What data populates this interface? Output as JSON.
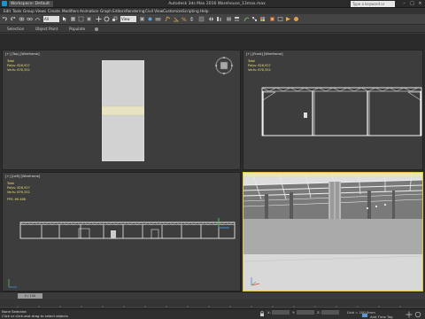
{
  "title_bar": {
    "workspace": "Workspace: Default",
    "title": "Autodesk 3ds Max 2016   Warehouse_13max.max",
    "search_placeholder": "Type a keyword or phrase"
  },
  "menu": [
    "Edit",
    "Tools",
    "Group",
    "Views",
    "Create",
    "Modifiers",
    "Animation",
    "Graph Editors",
    "Rendering",
    "Civil View",
    "Customize",
    "Scripting",
    "Help"
  ],
  "toolbar": {
    "filter_select": "All",
    "view_select": "View"
  },
  "ribbon": [
    "Selection",
    "Object Paint",
    "Populate"
  ],
  "viewports": {
    "top": {
      "label": "[+] [Top] [Wireframe]",
      "total_label": "Total",
      "polys_label": "Polys:",
      "polys": "826,927",
      "verts_label": "Verts:",
      "verts": "676,352"
    },
    "front": {
      "label": "[+] [Front] [Wireframe]",
      "total_label": "Total",
      "polys_label": "Polys:",
      "polys": "826,927",
      "verts_label": "Verts:",
      "verts": "676,352"
    },
    "left": {
      "label": "[+] [Left] [Wireframe]",
      "total_label": "Total",
      "polys_label": "Polys:",
      "polys": "826,927",
      "verts_label": "Verts:",
      "verts": "676,352",
      "fps_label": "FPS:",
      "fps": "69.466"
    },
    "perspective": {
      "label": "[+] [Perspective] [Realistic]"
    }
  },
  "timeline": {
    "slider_label": "0 / 100"
  },
  "status": {
    "selection": "None Selected",
    "prompt": "Click or click-and-drag to select objects",
    "x_label": "X:",
    "y_label": "Y:",
    "z_label": "Z:",
    "grid": "Grid = 100,0mm",
    "add_time_tag": "Add Time Tag"
  },
  "colors": {
    "accent": "#e6c53a",
    "stats": "#e8e070",
    "wire": "#ffffff",
    "viewport_bg": "#3d3d3d"
  }
}
